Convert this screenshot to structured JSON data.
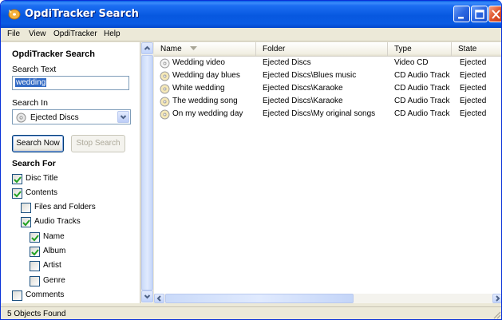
{
  "window": {
    "title": "OpdiTracker Search"
  },
  "menu": [
    "File",
    "View",
    "OpdiTracker",
    "Help"
  ],
  "left": {
    "panel_title": "OpdiTracker Search",
    "search_text_label": "Search Text",
    "search_text_value": "wedding",
    "search_in_label": "Search In",
    "search_in_value": "Ejected Discs",
    "search_now": "Search Now",
    "stop_search": "Stop Search",
    "search_for_label": "Search For",
    "options": [
      {
        "label": "Disc Title",
        "checked": true
      },
      {
        "label": "Contents",
        "checked": true
      },
      {
        "label": "Files and Folders",
        "checked": false
      },
      {
        "label": "Audio Tracks",
        "checked": true
      },
      {
        "label": "Name",
        "checked": true
      },
      {
        "label": "Album",
        "checked": true
      },
      {
        "label": "Artist",
        "checked": false
      },
      {
        "label": "Genre",
        "checked": false
      },
      {
        "label": "Comments",
        "checked": false
      }
    ]
  },
  "results": {
    "columns": [
      "Name",
      "Folder",
      "Type",
      "State"
    ],
    "rows": [
      {
        "name": "Wedding video",
        "folder": "Ejected Discs",
        "type": "Video CD",
        "state": "Ejected"
      },
      {
        "name": "Wedding day blues",
        "folder": "Ejected Discs\\Blues music",
        "type": "CD Audio Track",
        "state": "Ejected"
      },
      {
        "name": "White wedding",
        "folder": "Ejected Discs\\Karaoke",
        "type": "CD Audio Track",
        "state": "Ejected"
      },
      {
        "name": "The wedding song",
        "folder": "Ejected Discs\\Karaoke",
        "type": "CD Audio Track",
        "state": "Ejected"
      },
      {
        "name": "On my wedding day",
        "folder": "Ejected Discs\\My original songs",
        "type": "CD Audio Track",
        "state": "Ejected"
      }
    ]
  },
  "status": {
    "text": "5 Objects Found"
  }
}
